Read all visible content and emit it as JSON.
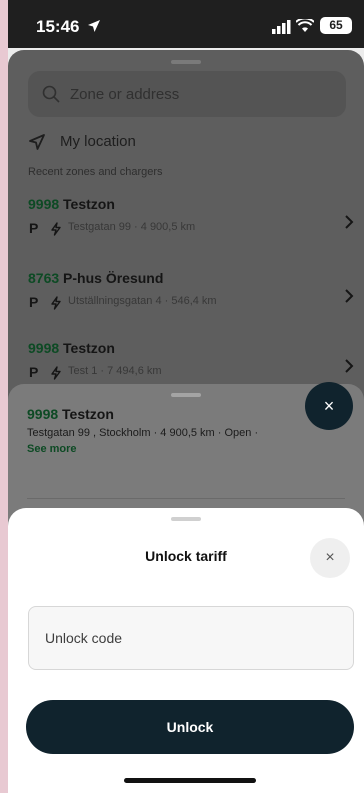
{
  "status_bar": {
    "time": "15:46",
    "battery": "65"
  },
  "search": {
    "placeholder": "Zone or address"
  },
  "my_location": {
    "label": "My location"
  },
  "recent": {
    "heading": "Recent zones and chargers",
    "items": [
      {
        "number": "9998",
        "name": "Testzon",
        "address": "Testgatan 99 · 4 900,5 km"
      },
      {
        "number": "8763",
        "name": "P-hus Öresund",
        "address": "Utställningsgatan 4 · 546,4 km"
      },
      {
        "number": "9998",
        "name": "Testzon",
        "address": "Test 1 · 7 494,6 km"
      }
    ]
  },
  "zone_card": {
    "number": "9998",
    "name": "Testzon",
    "details": "Testgatan 99 , Stockholm · 4 900,5 km · Open ·",
    "see_more": "See more",
    "close": "×"
  },
  "unlock_sheet": {
    "title": "Unlock tariff",
    "close": "×",
    "code_placeholder": "Unlock code",
    "unlock_label": "Unlock"
  },
  "icons": {
    "parking": "P",
    "charger": "bolt-icon",
    "chevron": "chevron-right-icon"
  }
}
